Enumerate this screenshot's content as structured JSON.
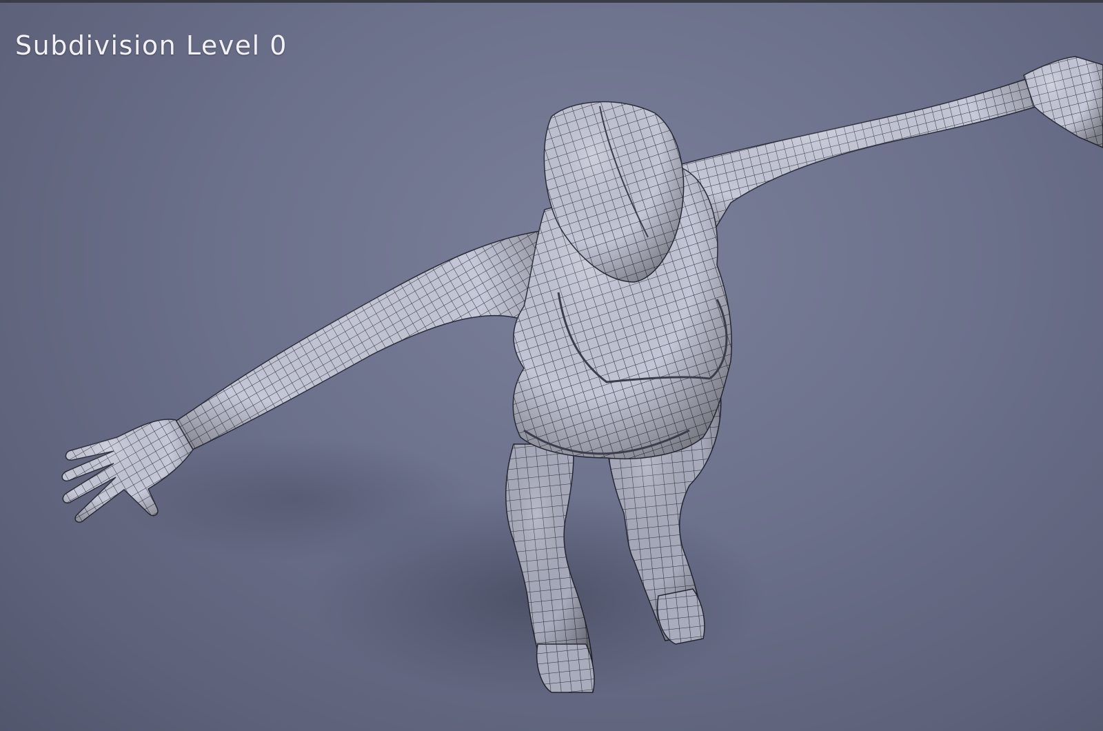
{
  "caption": {
    "text": "Subdivision Level 0"
  },
  "scene": {
    "subject": "wireframe-humanoid-figure",
    "background_color": "#6b708b",
    "mesh_color": "#c9ccdc",
    "wire_color": "#2a2c38"
  }
}
